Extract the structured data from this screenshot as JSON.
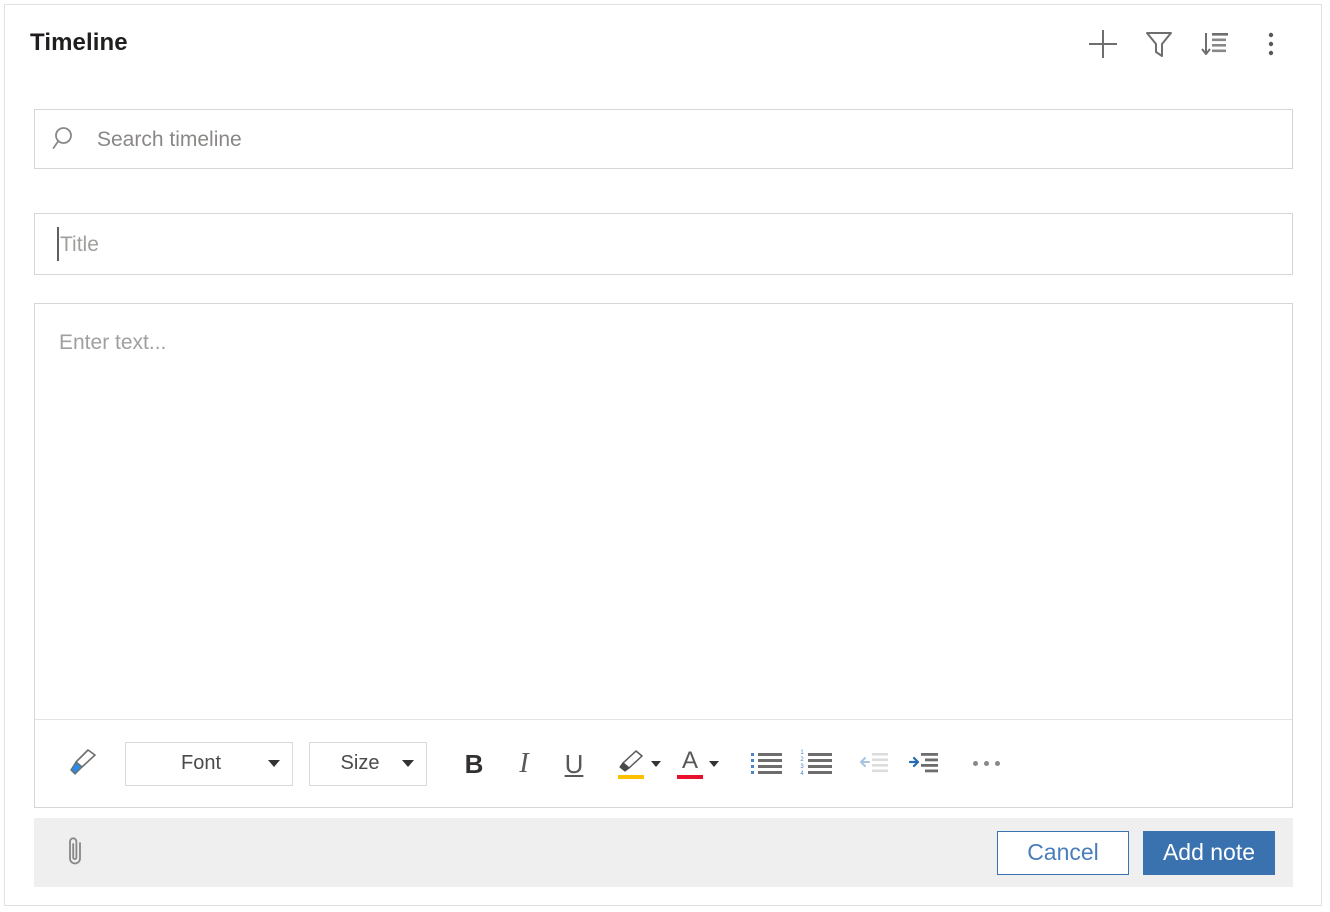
{
  "panel": {
    "title": "Timeline"
  },
  "header_actions": [
    {
      "name": "add-button",
      "icon": "plus-icon",
      "label": "Add"
    },
    {
      "name": "filter-button",
      "icon": "filter-icon",
      "label": "Filter"
    },
    {
      "name": "sort-button",
      "icon": "sort-descending-icon",
      "label": "Sort"
    },
    {
      "name": "more-options-button",
      "icon": "more-vertical-icon",
      "label": "More options"
    }
  ],
  "search": {
    "placeholder": "Search timeline",
    "value": "",
    "icon": "search-icon"
  },
  "note_form": {
    "title_field": {
      "placeholder": "Title",
      "value": "",
      "focused": true
    },
    "body_field": {
      "placeholder": "Enter text...",
      "value": ""
    }
  },
  "format_toolbar": {
    "format_painter": {
      "label": "Format painter",
      "icon": "format-painter-icon"
    },
    "font_select": {
      "label": "Font",
      "value": "Font"
    },
    "size_select": {
      "label": "Size",
      "value": "Size"
    },
    "bold": {
      "label": "B"
    },
    "italic": {
      "label": "I"
    },
    "underline": {
      "label": "U"
    },
    "highlight": {
      "label": "Text highlight color",
      "icon": "highlighter-icon",
      "color": "#ffc000"
    },
    "font_color": {
      "label": "A",
      "icon": "font-color-icon",
      "color": "#e8112d"
    },
    "bulleted_list": {
      "label": "Bulleted list",
      "icon": "bulleted-list-icon"
    },
    "numbered_list": {
      "label": "Numbered list",
      "icon": "numbered-list-icon"
    },
    "decrease_indent": {
      "label": "Decrease indent",
      "icon": "decrease-indent-icon"
    },
    "increase_indent": {
      "label": "Increase indent",
      "icon": "increase-indent-icon"
    },
    "more_formatting": {
      "label": "More formatting options",
      "icon": "ellipsis-icon"
    }
  },
  "action_bar": {
    "attach": {
      "label": "Attach file",
      "icon": "paperclip-icon"
    },
    "cancel_label": "Cancel",
    "submit_label": "Add note"
  },
  "colors": {
    "accent": "#3a72b0",
    "cancel_text": "#4a7ebb",
    "bar_background": "#efefef",
    "border": "#d6d6d6",
    "placeholder_text": "#a19f9d",
    "highlight_yellow": "#ffc000",
    "font_color_red": "#e8112d"
  }
}
